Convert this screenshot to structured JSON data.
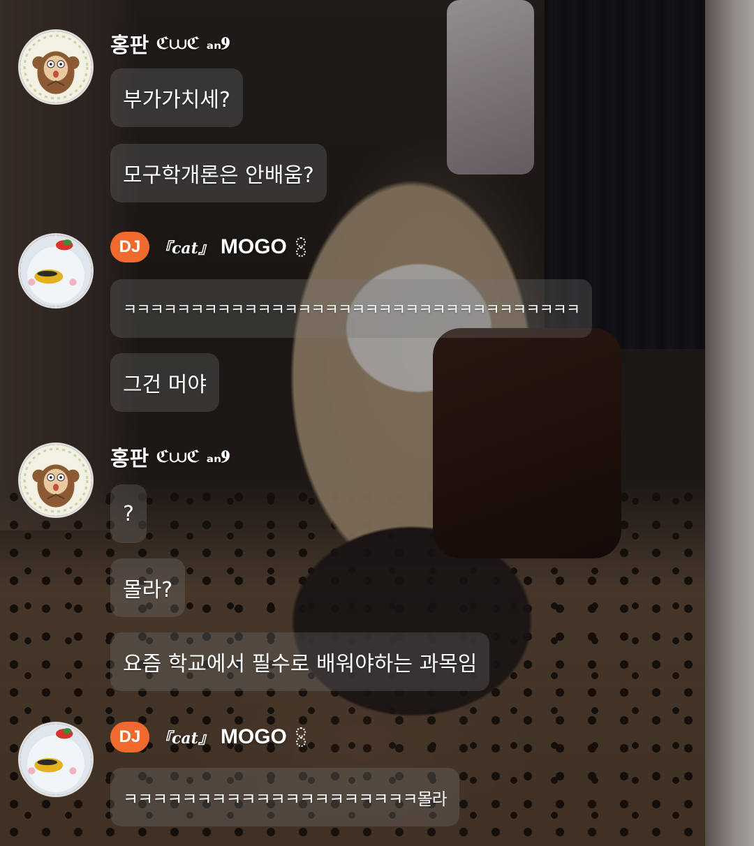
{
  "chat": {
    "messages": [
      {
        "sender": "홍판",
        "sender_suffix": "ℭ⩊ℭ ₐₙ𝟗",
        "avatar": "monkey-avatar",
        "bubbles": [
          "부가가치세?",
          "모구학개론은 안배움?"
        ]
      },
      {
        "badge": "DJ",
        "sender_prefix": "『cat』",
        "sender": "MOGO",
        "avatar": "bird-avatar",
        "bubbles": [
          "ㅋㅋㅋㅋㅋㅋㅋㅋㅋㅋㅋㅋㅋㅋㅋㅋㅋㅋㅋㅋㅋㅋㅋㅋㅋㅋㅋㅋㅋㅋㅋㅋㅋㅋ",
          "그건 머야"
        ]
      },
      {
        "sender": "홍판",
        "sender_suffix": "ℭ⩊ℭ ₐₙ𝟗",
        "avatar": "monkey-avatar",
        "bubbles": [
          "?",
          "몰라?",
          "요즘 학교에서 필수로 배워야하는 과목임"
        ]
      },
      {
        "badge": "DJ",
        "sender_prefix": "『cat』",
        "sender": "MOGO",
        "avatar": "bird-avatar",
        "bubbles": [
          "ㅋㅋㅋㅋㅋㅋㅋㅋㅋㅋㅋㅋㅋㅋㅋㅋㅋㅋㅋㅋ몰라"
        ]
      }
    ]
  },
  "colors": {
    "dj_badge": "#f06a2e",
    "bubble_bg": "rgba(120,120,120,0.30)",
    "text": "#ffffff"
  }
}
